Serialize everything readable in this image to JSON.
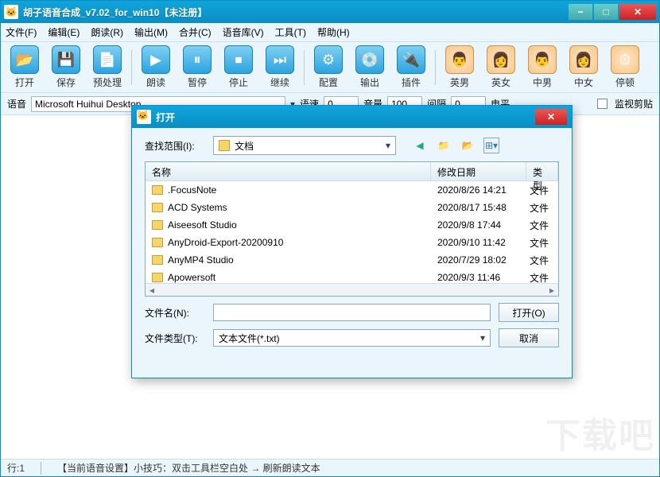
{
  "window": {
    "title": "胡子语音合成_v7.02_for_win10【未注册】"
  },
  "menu": {
    "file": "文件(F)",
    "edit": "编辑(E)",
    "read": "朗读(R)",
    "output": "输出(M)",
    "merge": "合并(C)",
    "voicelib": "语音库(V)",
    "tool": "工具(T)",
    "help": "帮助(H)"
  },
  "toolbar": {
    "open": "打开",
    "save": "保存",
    "preprocess": "预处理",
    "read": "朗读",
    "pause": "暂停",
    "stop": "停止",
    "continue": "继续",
    "config": "配置",
    "output": "输出",
    "plugin": "插件",
    "enman": "英男",
    "enwoman": "英女",
    "cnman": "中男",
    "cnwoman": "中女",
    "pauseword": "停顿"
  },
  "params": {
    "voice_label": "语音",
    "voice_value": "Microsoft Huihui Desktop",
    "rate_label": "语速",
    "rate_value": "0",
    "volume_label": "音量",
    "volume_value": "100",
    "interval_label": "间隔",
    "interval_value": "0",
    "level_label": "电平",
    "monitor_label": "监视剪贴"
  },
  "dialog": {
    "title": "打开",
    "lookin_label": "查找范围(I):",
    "lookin_value": "文档",
    "columns": {
      "name": "名称",
      "date": "修改日期",
      "type": "类型"
    },
    "rows": [
      {
        "name": ".FocusNote",
        "date": "2020/8/26 14:21",
        "type": "文件"
      },
      {
        "name": "ACD Systems",
        "date": "2020/8/17 15:48",
        "type": "文件"
      },
      {
        "name": "Aiseesoft Studio",
        "date": "2020/9/8 17:44",
        "type": "文件"
      },
      {
        "name": "AnyDroid-Export-20200910",
        "date": "2020/9/10 11:42",
        "type": "文件"
      },
      {
        "name": "AnyMP4 Studio",
        "date": "2020/7/29 18:02",
        "type": "文件"
      },
      {
        "name": "Apowersoft",
        "date": "2020/9/3 11:46",
        "type": "文件"
      }
    ],
    "filename_label": "文件名(N):",
    "filename_value": "",
    "filetype_label": "文件类型(T):",
    "filetype_value": "文本文件(*.txt)",
    "open_btn": "打开(O)",
    "cancel_btn": "取消"
  },
  "status": {
    "line": "行:1",
    "tip": "【当前语音设置】小技巧：双击工具栏空白处 → 刷新朗读文本"
  },
  "watermark": "下载吧"
}
